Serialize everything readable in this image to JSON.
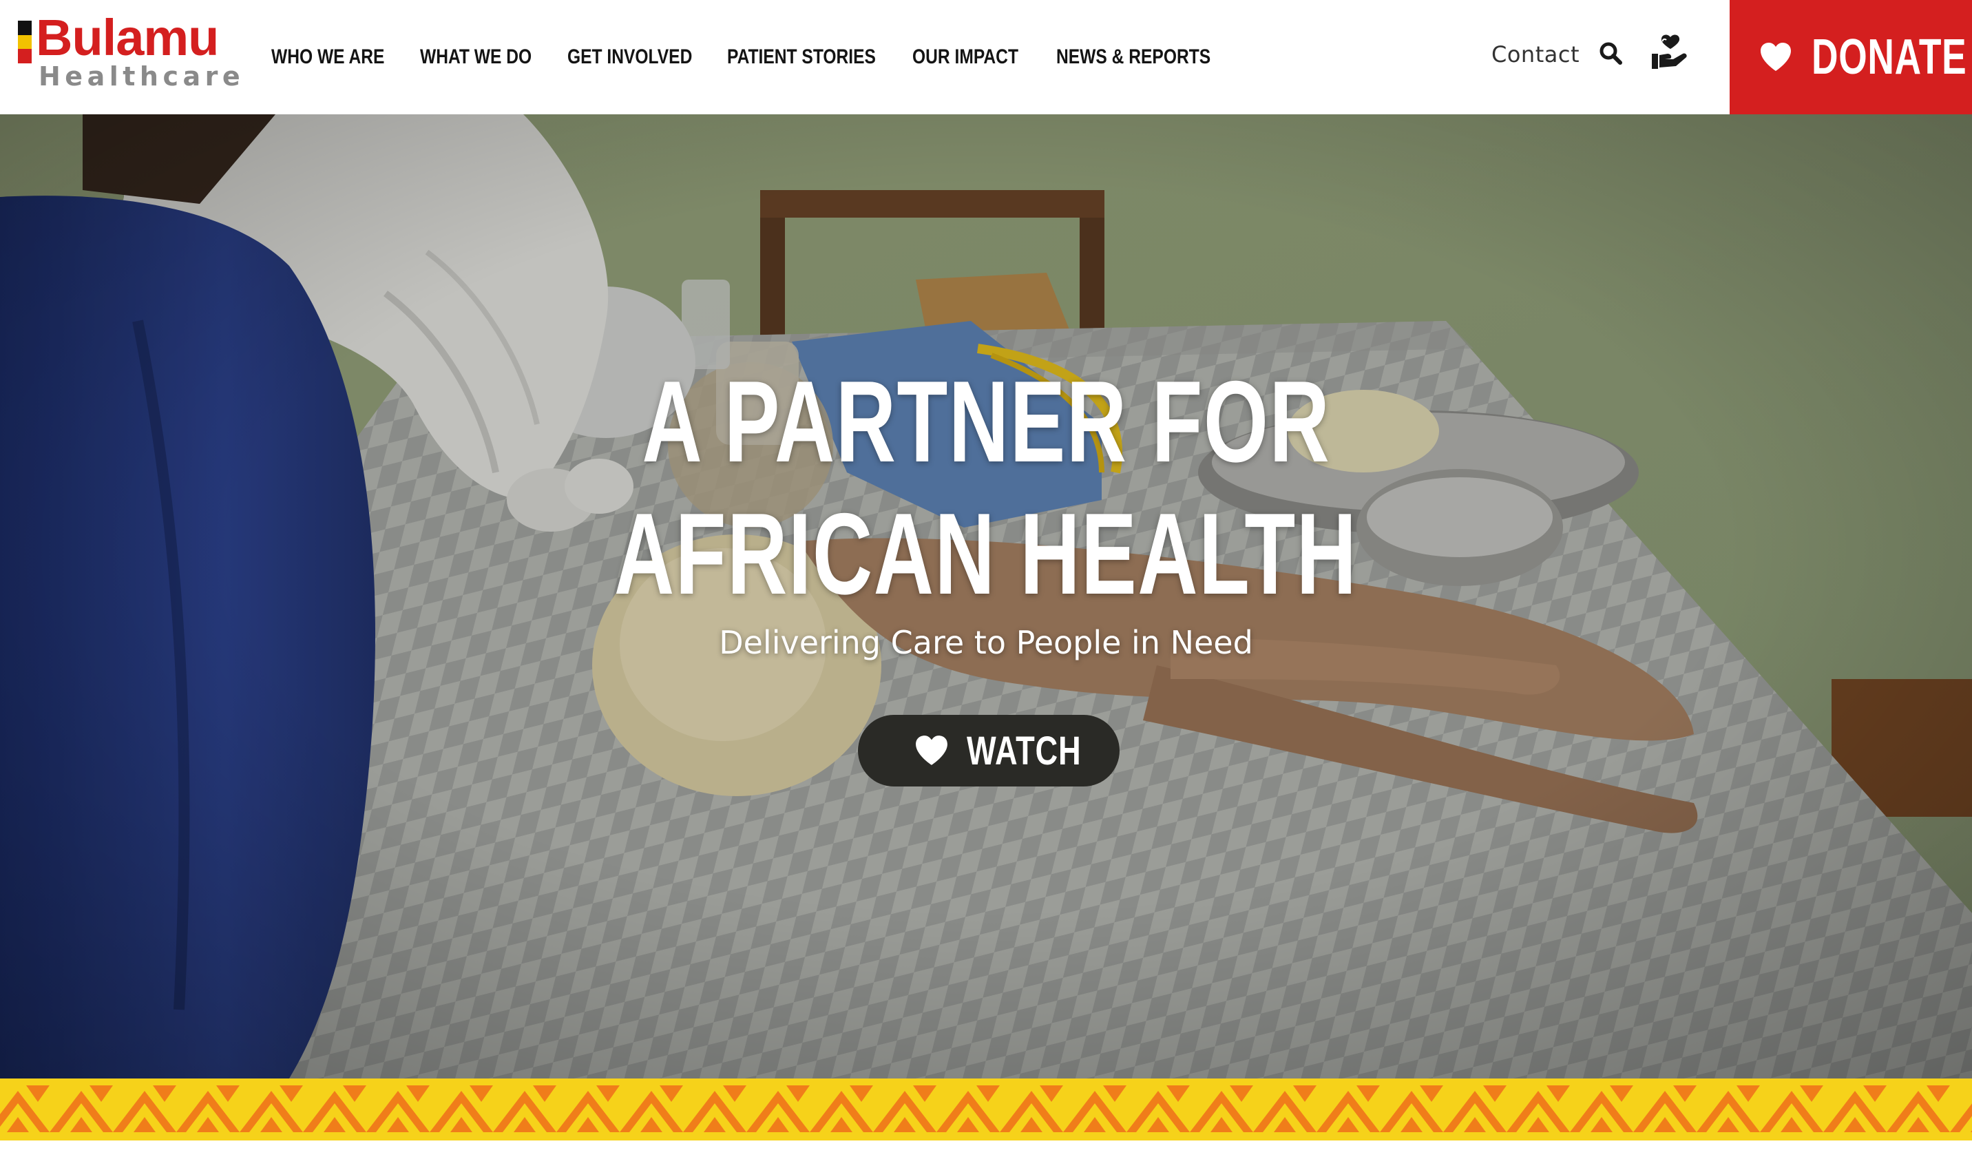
{
  "brand": {
    "name": "Bulamu",
    "sub": "Healthcare",
    "flag_colors": [
      "#111111",
      "#f2c200",
      "#d41f1f"
    ],
    "accent": "#d41f1f"
  },
  "nav": {
    "items": [
      {
        "label": "WHO WE ARE"
      },
      {
        "label": "WHAT WE DO"
      },
      {
        "label": "GET INVOLVED"
      },
      {
        "label": "PATIENT STORIES"
      },
      {
        "label": "OUR IMPACT"
      },
      {
        "label": "NEWS & REPORTS"
      }
    ],
    "contact_label": "Contact",
    "search_icon": "search-icon",
    "care_icon": "hand-heart-icon"
  },
  "donate": {
    "label": "DONATE",
    "icon": "heart-icon",
    "color": "#d41f1f"
  },
  "hero": {
    "title_line1": "A PARTNER FOR",
    "title_line2": "AFRICAN HEALTH",
    "subtitle": "Delivering Care to People in Need",
    "watch_label": "WATCH",
    "watch_icon": "heart-icon"
  },
  "pattern": {
    "background": "#f6d21a",
    "accent": "#f07d1a"
  }
}
